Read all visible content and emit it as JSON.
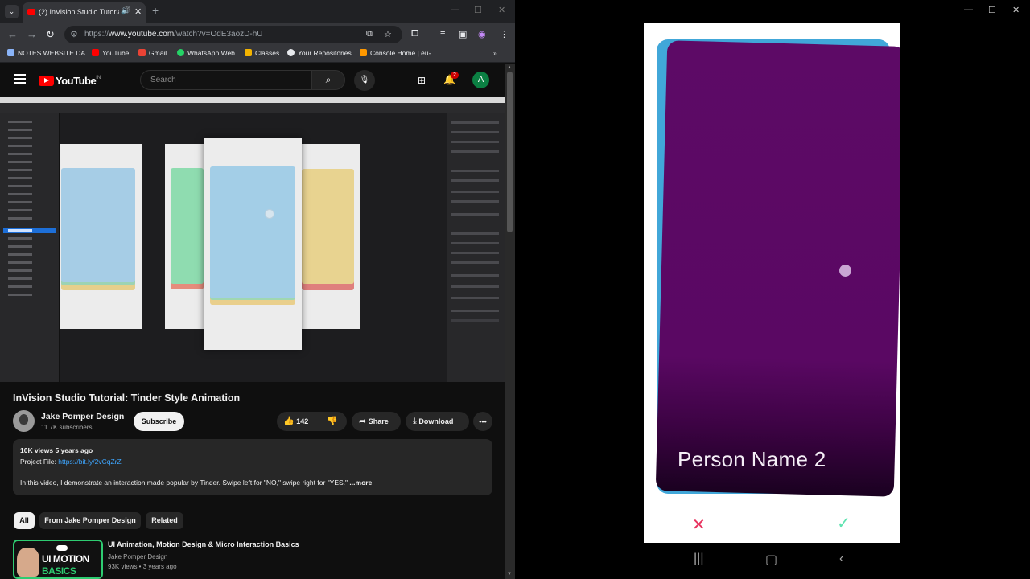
{
  "browser": {
    "tab_title": "(2) InVision Studio Tutorial: Tinder Style Animation",
    "url_prefix": "https://",
    "url_domain": "www.youtube.com",
    "url_path": "/watch?v=OdE3aozD-hU",
    "bookmarks": [
      "NOTES WEBSITE DA...",
      "YouTube",
      "Gmail",
      "WhatsApp Web",
      "Classes",
      "Your Repositories",
      "Console Home | eu-..."
    ]
  },
  "youtube": {
    "logo": "YouTube",
    "region": "IN",
    "search_placeholder": "Search",
    "notifications": "2",
    "avatar_letter": "A"
  },
  "video": {
    "title": "InVision Studio Tutorial: Tinder Style Animation",
    "channel": "Jake Pomper Design",
    "subscribers": "11.7K subscribers",
    "subscribe": "Subscribe",
    "likes": "142",
    "share": "Share",
    "download": "Download",
    "views_date": "10K views  5 years ago",
    "project_label": "Project File: ",
    "project_link": "https://bit.ly/2vCqZrZ",
    "description": "In this video, I demonstrate an interaction made popular by Tinder. Swipe left for \"NO,\" swipe right for \"YES.\"",
    "more": "...more"
  },
  "chips": [
    "All",
    "From Jake Pomper Design",
    "Related"
  ],
  "related": {
    "thumb_line1": "UI MOTION",
    "thumb_line2": "BASICS",
    "title": "UI Animation, Motion Design & Micro Interaction Basics",
    "channel": "Jake Pomper Design",
    "meta": "93K views • 3 years ago"
  },
  "phone": {
    "person_name": "Person Name 2",
    "colors": {
      "card_back": "#41a7d9",
      "card_front": "#5d0a66",
      "reject": "#e8335f",
      "accept": "#5fe3b0"
    }
  }
}
